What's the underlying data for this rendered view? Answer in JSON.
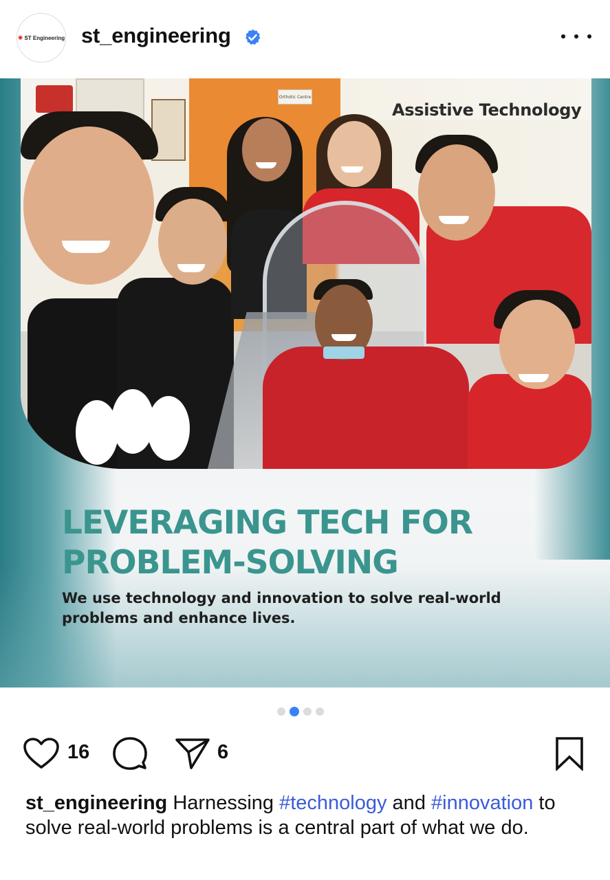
{
  "header": {
    "avatar_brand": "ST Engineering",
    "username": "st_engineering",
    "verified_icon": "verified-badge-icon",
    "more_icon": "more-options-icon"
  },
  "slide": {
    "sign_text_1": "Assistive",
    "sign_text_2": "Technology",
    "small_sign": "Orthotic Centre",
    "headline_line1": "LEVERAGING TECH FOR",
    "headline_line2": "PROBLEM-SOLVING",
    "subline_line1": "We use technology and innovation to solve real-world",
    "subline_line2": "problems and enhance lives.",
    "headline_color": "#3a958e"
  },
  "carousel": {
    "total": 4,
    "active_index": 1,
    "active_color": "#3b82f6"
  },
  "actions": {
    "like_icon": "heart-icon",
    "like_count": "16",
    "comment_icon": "comment-icon",
    "share_icon": "share-icon",
    "share_count": "6",
    "save_icon": "bookmark-icon"
  },
  "caption": {
    "username": "st_engineering",
    "text_1": " Harnessing ",
    "hashtag_1": "#technology",
    "text_2": " and ",
    "hashtag_2": "#innovation",
    "text_3": " to solve real-world problems is a central part of what we do.",
    "hashtag_color": "#3b5bd9"
  }
}
